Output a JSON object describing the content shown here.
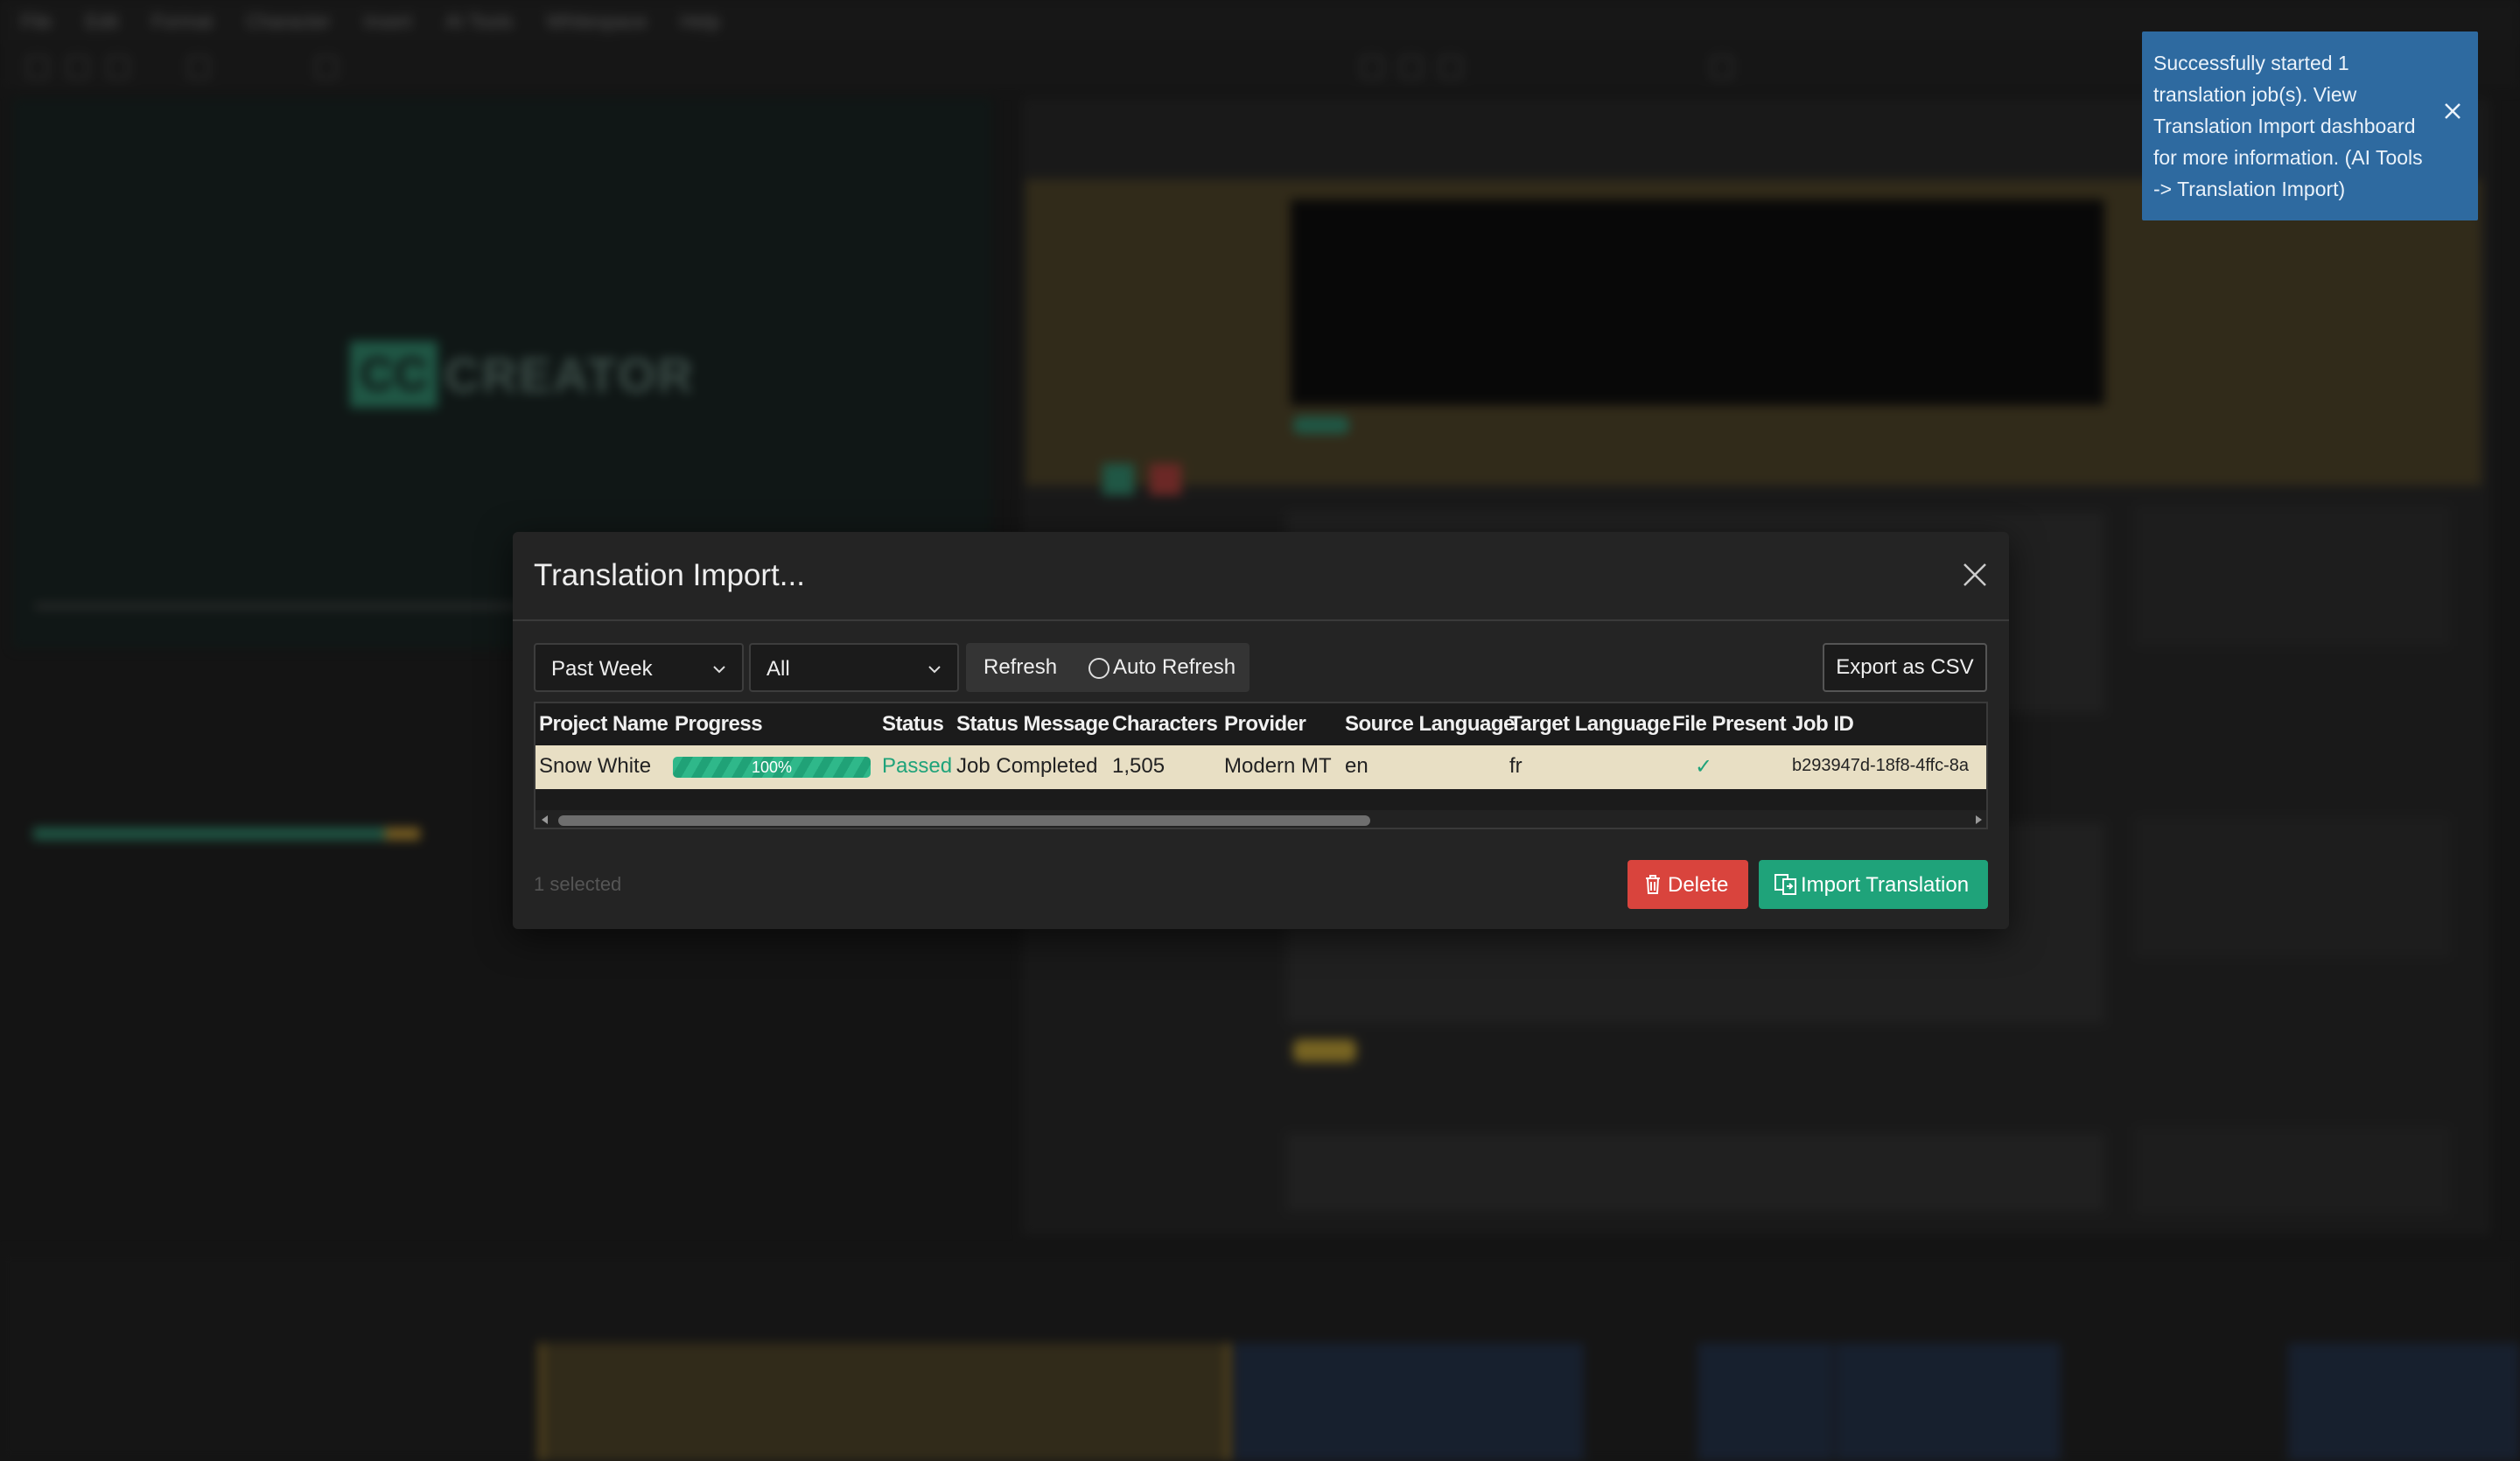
{
  "background_app": {
    "menu": [
      "File",
      "Edit",
      "Format",
      "Character",
      "Insert",
      "AI Tools",
      "Whitespace",
      "Help"
    ],
    "logo": {
      "mark": "CC",
      "word": "CREATOR"
    }
  },
  "toast": {
    "message": "Successfully started 1 translation job(s). View Translation Import dashboard for more information. (AI Tools -> Translation Import)",
    "close_icon": "close-icon",
    "color": "#2e6aa0"
  },
  "modal": {
    "title": "Translation Import...",
    "close_icon": "close-icon",
    "filters": {
      "date_range": "Past Week",
      "status": "All"
    },
    "refresh_label": "Refresh",
    "auto_refresh_label": "Auto Refresh",
    "auto_refresh_checked": false,
    "export_label": "Export as CSV",
    "table": {
      "columns": [
        "Project Name",
        "Progress",
        "Status",
        "Status Message",
        "Characters",
        "Provider",
        "Source Language",
        "Target Language",
        "File Present",
        "Job ID"
      ],
      "rows": [
        {
          "project_name": "Snow White",
          "progress": "100%",
          "progress_value": 1.0,
          "status": "Passed",
          "status_message": "Job Completed",
          "characters": "1,505",
          "provider": "Modern MT",
          "source_language": "en",
          "target_language": "fr",
          "file_present": "✓",
          "job_id": "b293947d-18f8-4ffc-8a"
        }
      ],
      "selected_row_color": "#e8dfc4"
    },
    "selected_count": "1 selected",
    "delete_label": "Delete",
    "import_label": "Import Translation",
    "colors": {
      "delete": "#d9443d",
      "import": "#1fa37a",
      "passed": "#1fa37a",
      "progress": "#2fb88a"
    }
  }
}
